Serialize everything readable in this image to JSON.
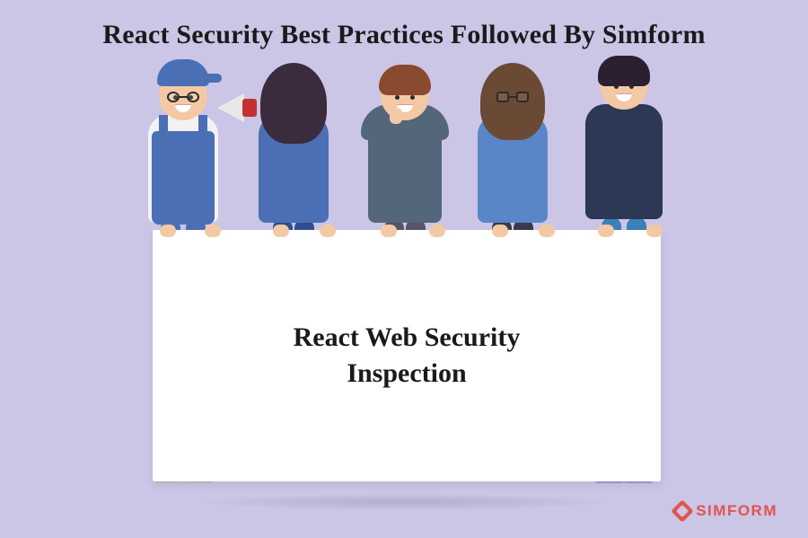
{
  "heading": "React Security Best Practices Followed By Simform",
  "card": {
    "title": "React Web Security\nInspection"
  },
  "brand": {
    "name": "SIMFORM",
    "accent": "#e2544c"
  }
}
